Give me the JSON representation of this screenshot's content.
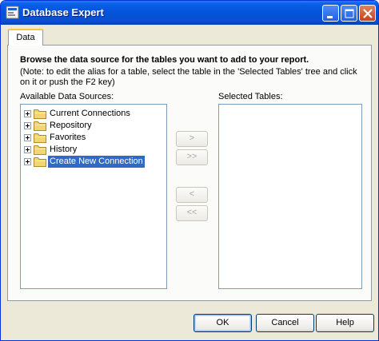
{
  "window": {
    "title": "Database Expert"
  },
  "tabs": [
    {
      "label": "Data"
    }
  ],
  "main": {
    "heading": "Browse the data source for the tables you want to add to your report.",
    "note": "(Note: to edit the alias for a table, select the table in the 'Selected Tables' tree and click on it or push the F2 key)",
    "available_label": "Available Data Sources:",
    "selected_label": "Selected Tables:",
    "tree": [
      {
        "label": "Current Connections",
        "selected": false
      },
      {
        "label": "Repository",
        "selected": false
      },
      {
        "label": "Favorites",
        "selected": false
      },
      {
        "label": "History",
        "selected": false
      },
      {
        "label": "Create New Connection",
        "selected": true
      }
    ],
    "move_buttons": {
      "add": ">",
      "add_all": ">>",
      "remove": "<",
      "remove_all": "<<"
    }
  },
  "footer": {
    "ok": "OK",
    "cancel": "Cancel",
    "help": "Help"
  },
  "colors": {
    "titlebar": "#0253d8",
    "selection": "#316ac5",
    "face": "#ece9d8"
  },
  "icons": [
    "app-icon",
    "minimize-icon",
    "maximize-icon",
    "close-icon",
    "expand-icon",
    "folder-icon"
  ]
}
